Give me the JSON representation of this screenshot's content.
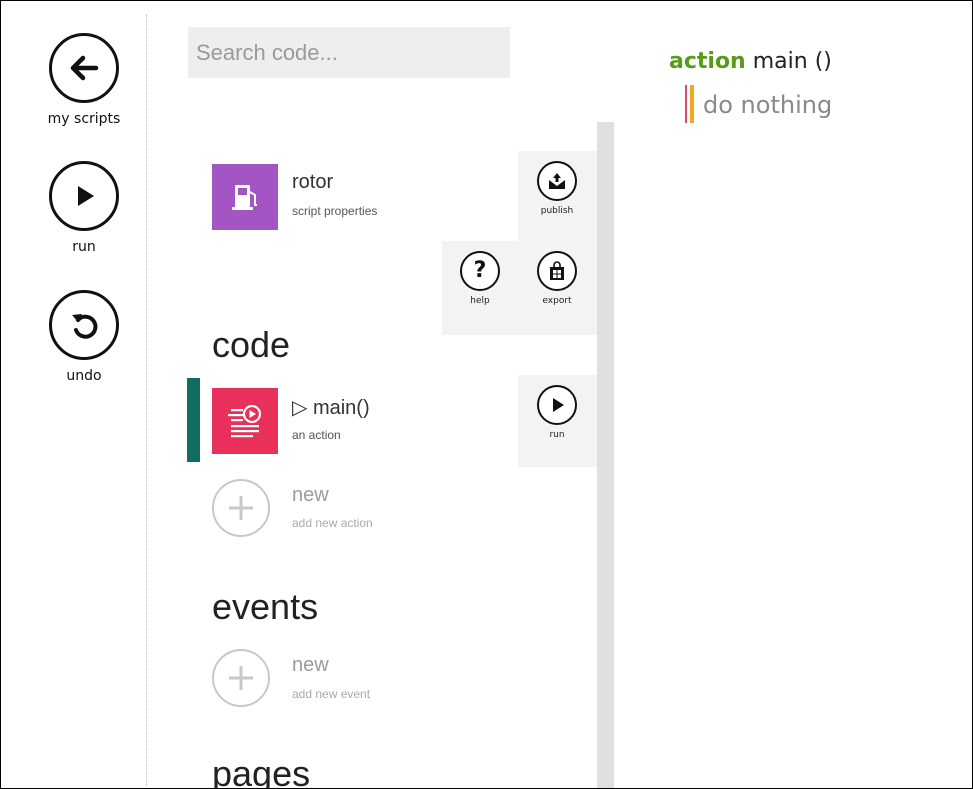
{
  "left_nav": {
    "back": {
      "label": "my scripts",
      "icon": "arrow-left-icon"
    },
    "run": {
      "label": "run",
      "icon": "play-icon"
    },
    "undo": {
      "label": "undo",
      "icon": "undo-icon"
    }
  },
  "search": {
    "placeholder": "Search code...",
    "value": ""
  },
  "script": {
    "name": "rotor",
    "subtitle": "script properties",
    "tile_color": "#a455c4",
    "icon": "gas-pump-icon"
  },
  "actions_panel": {
    "publish": {
      "label": "publish",
      "icon": "publish-icon"
    },
    "help": {
      "label": "help",
      "icon": "question-icon"
    },
    "export": {
      "label": "export",
      "icon": "store-bag-icon"
    },
    "run": {
      "label": "run",
      "icon": "play-icon"
    }
  },
  "sections": {
    "code": {
      "title": "code",
      "items": [
        {
          "title": "▷ main()",
          "subtitle": "an action",
          "tile_color": "#e8305a",
          "selected": true,
          "icon": "action-play-icon"
        },
        {
          "title": "new",
          "subtitle": "add new action",
          "icon": "plus-icon"
        }
      ]
    },
    "events": {
      "title": "events",
      "items": [
        {
          "title": "new",
          "subtitle": "add new event",
          "icon": "plus-icon"
        }
      ]
    },
    "pages": {
      "title": "pages"
    }
  },
  "editor": {
    "keyword": "action",
    "signature": "main ()",
    "body": "do nothing",
    "keyword_color": "#5a9a1a"
  },
  "colors": {
    "selection_marker": "#0f6e5f",
    "scrollbar": "#e0e0e0"
  }
}
